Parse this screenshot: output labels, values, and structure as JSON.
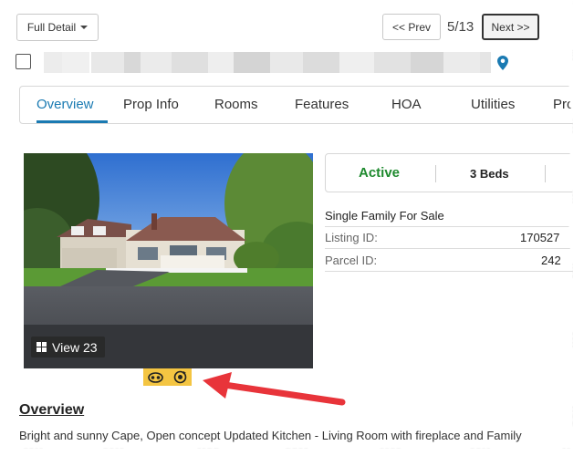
{
  "toolbar": {
    "detail_select": "Full Detail",
    "prev_label": "<< Prev",
    "counter": "5/13",
    "next_label": "Next >>"
  },
  "tabs": [
    {
      "label": "Overview",
      "active": true
    },
    {
      "label": "Prop Info"
    },
    {
      "label": "Rooms"
    },
    {
      "label": "Features"
    },
    {
      "label": "HOA"
    },
    {
      "label": "Utilities"
    },
    {
      "label": "Pro"
    }
  ],
  "photo": {
    "view_label": "View 23"
  },
  "status": {
    "state": "Active",
    "beds": "3 Beds"
  },
  "property": {
    "type": "Single Family For Sale",
    "listing_id_label": "Listing ID:",
    "listing_id_value": "170527",
    "parcel_id_label": "Parcel ID:",
    "parcel_id_value": "242"
  },
  "overview": {
    "title": "Overview",
    "text": "Bright and sunny Cape, Open concept Updated Kitchen - Living Room with fireplace and Family"
  },
  "colors": {
    "accent": "#1a7ab2",
    "active": "#1e8a2e",
    "arrow": "#e8343a",
    "icon_strip": "#f4c542"
  }
}
